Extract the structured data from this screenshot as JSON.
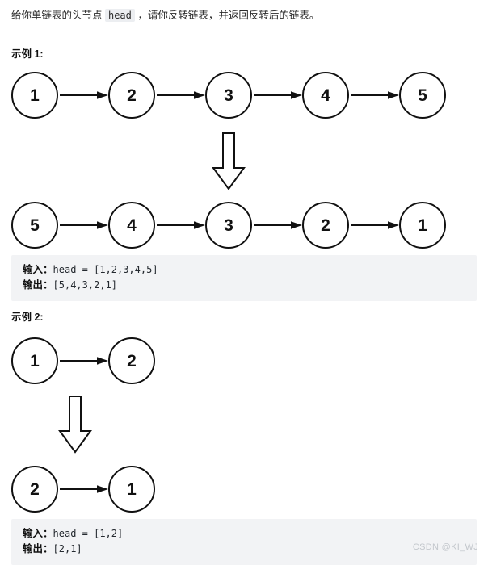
{
  "document": {
    "intro": {
      "before_code": "给你单链表的头节点 ",
      "code": "head",
      "after_code": " ，请你反转链表，并返回反转后的链表。"
    },
    "watermark": "CSDN @KI_WJ"
  },
  "examples": [
    {
      "title": "示例 1:",
      "input_list": {
        "values": [
          "1",
          "2",
          "3",
          "4",
          "5"
        ],
        "node_count": 5
      },
      "output_list": {
        "values": [
          "5",
          "4",
          "3",
          "2",
          "1"
        ],
        "node_count": 5
      },
      "transform_arrow": "down-block-arrow",
      "io": {
        "input_label": "输入：",
        "input_value": "head = [1,2,3,4,5]",
        "output_label": "输出：",
        "output_value": "[5,4,3,2,1]"
      }
    },
    {
      "title": "示例 2:",
      "input_list": {
        "values": [
          "1",
          "2"
        ],
        "node_count": 2
      },
      "output_list": {
        "values": [
          "2",
          "1"
        ],
        "node_count": 2
      },
      "transform_arrow": "down-block-arrow",
      "io": {
        "input_label": "输入：",
        "input_value": "head = [1,2]",
        "output_label": "输出：",
        "output_value": "[2,1]"
      }
    }
  ],
  "style": {
    "node_stroke": "#111111",
    "code_bg": "#f2f3f5",
    "inline_code_bg": "#eceef1",
    "watermark_color": "#c3c7cc"
  }
}
